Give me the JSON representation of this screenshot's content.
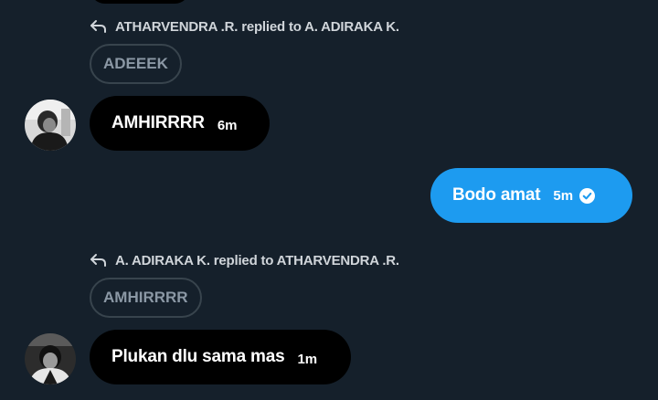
{
  "colors": {
    "background": "#15202b",
    "received_bubble": "#000000",
    "sent_bubble": "#1d9bf0",
    "quote_border": "#38444d",
    "quote_text": "#8b98a5"
  },
  "messages": [
    {
      "reply_context": "ATHARVENDRA .R. replied to A. ADIRAKA K.",
      "quoted": "ADEEEK",
      "text": "AMHIRRRR",
      "time": "6m",
      "icon": "reply-arrow-icon"
    },
    {
      "text": "Bodo amat",
      "time": "5m",
      "status_icon": "check-circle-icon"
    },
    {
      "reply_context": "A. ADIRAKA K. replied to ATHARVENDRA .R.",
      "quoted": "AMHIRRRR",
      "text": "Plukan dlu sama mas",
      "time": "1m",
      "icon": "reply-arrow-icon"
    }
  ]
}
